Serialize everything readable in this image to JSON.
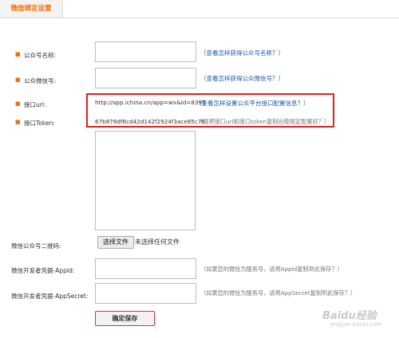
{
  "tab": {
    "title": "微信绑定设置"
  },
  "fields": {
    "account_name": {
      "label": "公众号名称:",
      "help": "（查看怎样获得公众号名称？）"
    },
    "account_id": {
      "label": "公众微信号:",
      "help": "（查看怎样获得公众微信号？）"
    },
    "interface_url": {
      "label": "接口url:",
      "value": "http://app.ichina.cn/app=wx&id=8395",
      "help": "（查看怎样设置公众平台接口配置信息？）"
    },
    "interface_token": {
      "label": "接口Token:",
      "value": "67b878df6cd42d142f2924f3ace85c78",
      "hint": "（请将接口url和接口token复制后按规定配置好？）"
    },
    "qr_code": {
      "label": "微信公众号二维码:",
      "button_label": "选择文件",
      "file_status": "未选择任何文件"
    },
    "app_id": {
      "label": "微信开发者凭据-AppId:",
      "hint": "（如果您的微信为服务号，请将Appid复制到此保存？）"
    },
    "app_secret": {
      "label": "微信开发者凭据-AppSecret:",
      "hint": "（如果您的微信为服务号，请将AppSecret复制到此保存？）"
    }
  },
  "actions": {
    "save_label": "确定保存"
  },
  "bullet_symbol": "■",
  "watermark": {
    "brand": "Baidu经验",
    "url": "jingyan.baidu.com"
  },
  "colors": {
    "accent": "#ff6a00",
    "link": "#1a5aa8",
    "highlight_border": "#e0201e"
  }
}
